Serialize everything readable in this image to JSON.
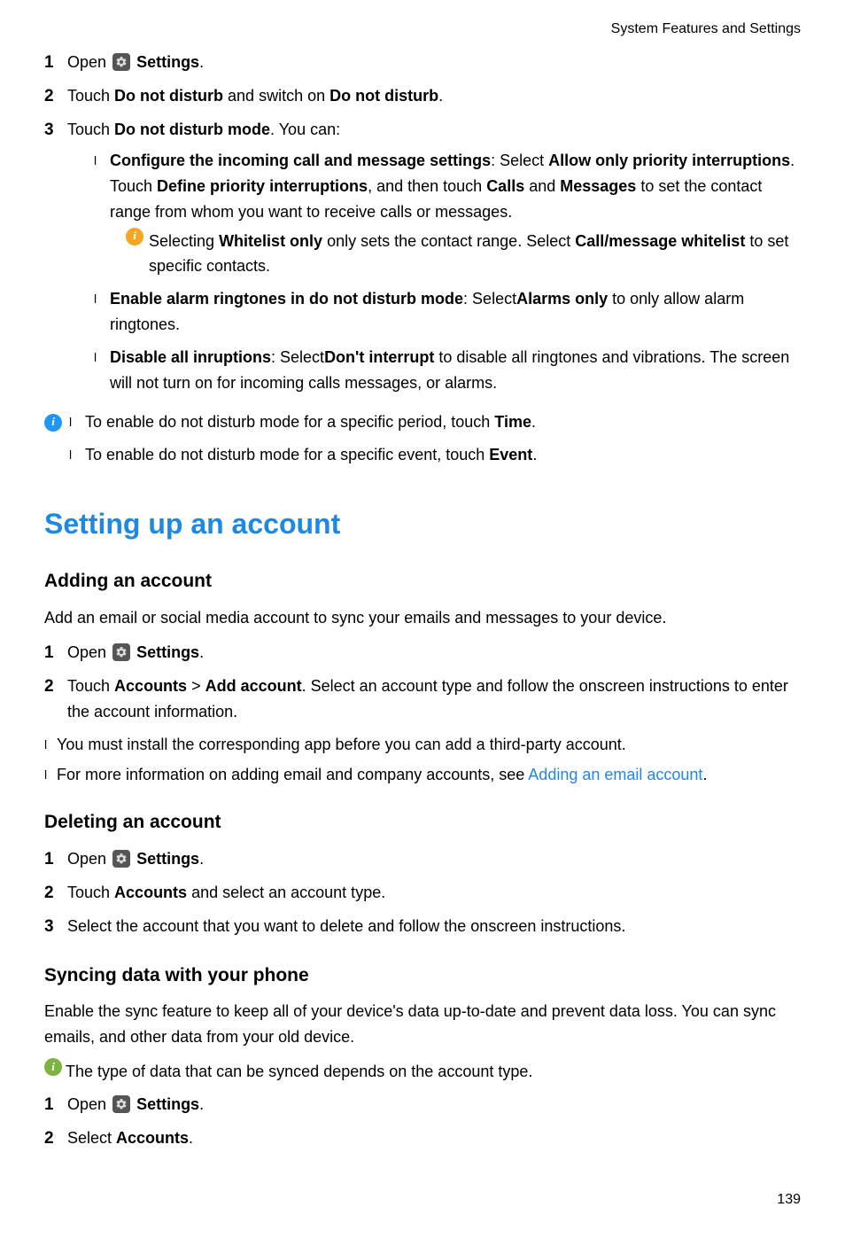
{
  "header": "System Features and Settings",
  "steps1": {
    "n1": "1",
    "s1a": "Open ",
    "s1b": "Settings",
    "s1c": ".",
    "n2": "2",
    "s2a": "Touch ",
    "s2b": "Do not disturb",
    "s2c": " and switch on ",
    "s2d": "Do not disturb",
    "s2e": ".",
    "n3": "3",
    "s3a": "Touch ",
    "s3b": "Do not disturb mode",
    "s3c": ". You can:"
  },
  "sub": {
    "b1": "l",
    "i1a": "Configure the incoming call and message settings",
    "i1b": ": Select ",
    "i1c": "Allow only priority interruptions",
    "i1d": ". Touch ",
    "i1e": "Define priority interruptions",
    "i1f": ", and then touch ",
    "i1g": "Calls",
    "i1h": " and ",
    "i1i": "Messages",
    "i1j": " to set the contact range from whom you want to receive calls or messages.",
    "note1a": "Selecting ",
    "note1b": "Whitelist only",
    "note1c": " only sets the contact range. Select ",
    "note1d": "Call/message whitelist",
    "note1e": " to set specific contacts.",
    "b2": "l",
    "i2a": "Enable alarm ringtones in do not disturb mode",
    "i2b": ": Select",
    "i2c": "Alarms only",
    "i2d": " to only allow alarm ringtones.",
    "b3": "l",
    "i3a": "Disable all inruptions",
    "i3b": ": Select",
    "i3c": "Don't interrupt",
    "i3d": " to disable all ringtones and vibrations. The screen will not turn on for incoming calls messages, or alarms."
  },
  "infolist": {
    "b1": "l",
    "l1a": "To enable do not disturb mode for a specific period, touch ",
    "l1b": "Time",
    "l1c": ".",
    "b2": "l",
    "l2a": "To enable do not disturb mode for a specific event, touch ",
    "l2b": "Event",
    "l2c": "."
  },
  "section_title": "Setting up an account",
  "adding": {
    "heading": "Adding an account",
    "intro": "Add an email or social media account to sync your emails and messages to your device.",
    "n1": "1",
    "s1a": "Open ",
    "s1b": "Settings",
    "s1c": ".",
    "n2": "2",
    "s2a": "Touch ",
    "s2b": "Accounts",
    "s2c": " > ",
    "s2d": "Add account",
    "s2e": ". Select an account type and follow the onscreen instructions to enter the account information.",
    "pb1": "l",
    "p1": "You must install the corresponding app before you can add a third-party account.",
    "pb2": "l",
    "p2a": "For more information on adding email and company accounts, see ",
    "p2b": "Adding an email account",
    "p2c": "."
  },
  "deleting": {
    "heading": "Deleting an account",
    "n1": "1",
    "s1a": "Open ",
    "s1b": "Settings",
    "s1c": ".",
    "n2": "2",
    "s2a": "Touch ",
    "s2b": "Accounts",
    "s2c": " and select an account type.",
    "n3": "3",
    "s3": "Select the account that you want to delete and follow the onscreen instructions."
  },
  "syncing": {
    "heading": "Syncing data with your phone",
    "intro": "Enable the sync feature to keep all of your device's data up-to-date and prevent data loss. You can sync emails, and other data from your old device.",
    "note": "The type of data that can be synced depends on the account type.",
    "n1": "1",
    "s1a": "Open ",
    "s1b": "Settings",
    "s1c": ".",
    "n2": "2",
    "s2a": "Select ",
    "s2b": "Accounts",
    "s2c": "."
  },
  "page_number": "139"
}
